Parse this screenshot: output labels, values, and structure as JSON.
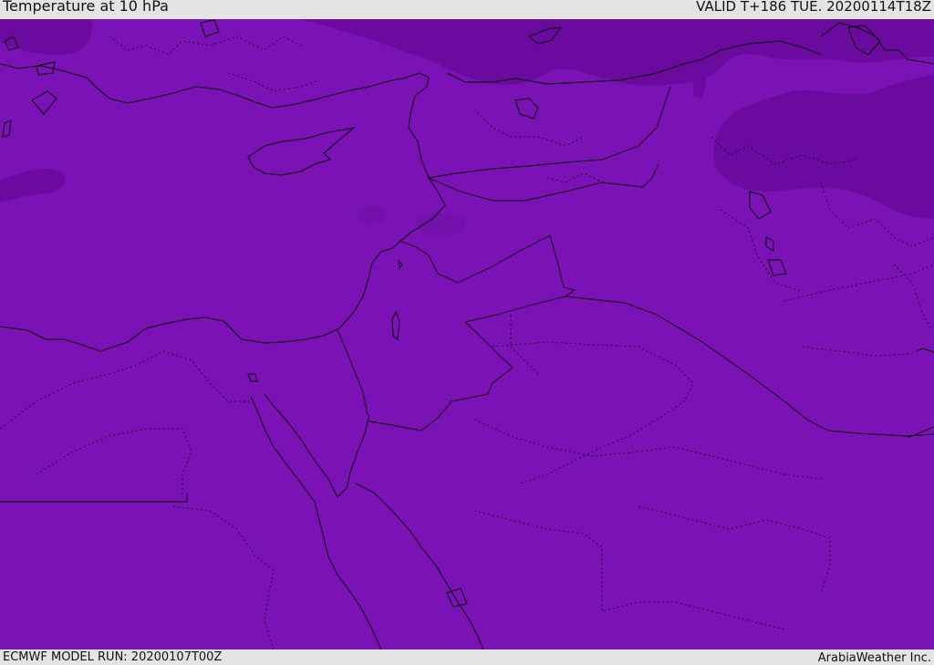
{
  "header": {
    "title": "Temperature at 10 hPa",
    "valid": "VALID T+186 TUE. 20200114T18Z"
  },
  "footer": {
    "model_run": "ECMWF MODEL RUN: 20200107T00Z",
    "credit": "ArabiaWeather Inc."
  },
  "map": {
    "colors": {
      "field_base": "#7a12b5",
      "field_cold": "#6a0a9e",
      "field_mid": "#7311ad",
      "coast": "#000000",
      "border": "#000000"
    }
  }
}
